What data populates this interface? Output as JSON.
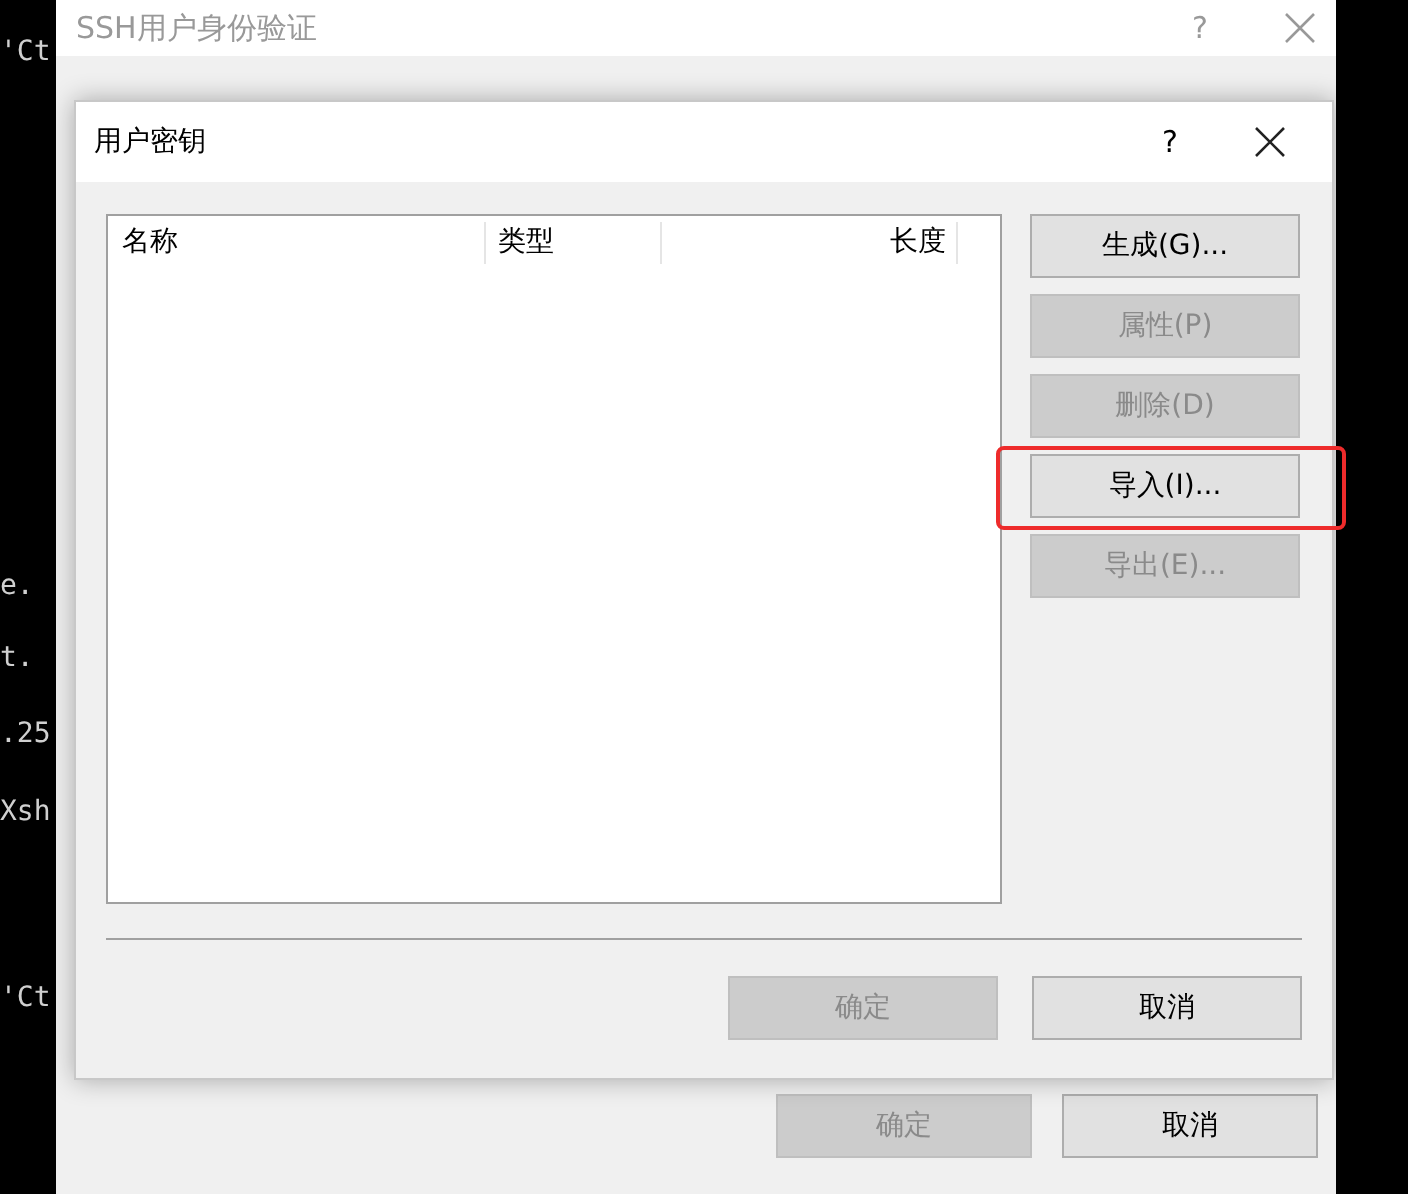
{
  "terminal_fragments": [
    {
      "text": "'Ct"
    },
    {
      "text": "e."
    },
    {
      "text": "t."
    },
    {
      "text": ".25"
    },
    {
      "text": "Xsh"
    },
    {
      "text": "'Ct"
    }
  ],
  "back_window": {
    "title": "SSH用户身份验证",
    "help": "?",
    "buttons": [
      {
        "label": "确定",
        "disabled": true
      },
      {
        "label": "取消",
        "disabled": false
      }
    ]
  },
  "dialog": {
    "title": "用户密钥",
    "help": "?",
    "table": {
      "columns": [
        "名称",
        "类型",
        "长度"
      ]
    },
    "side_buttons": [
      {
        "label": "生成(G)...",
        "disabled": false,
        "highlighted": false
      },
      {
        "label": "属性(P)",
        "disabled": true,
        "highlighted": false
      },
      {
        "label": "删除(D)",
        "disabled": true,
        "highlighted": false
      },
      {
        "label": "导入(I)...",
        "disabled": false,
        "highlighted": true
      },
      {
        "label": "导出(E)...",
        "disabled": true,
        "highlighted": false
      }
    ],
    "buttons": [
      {
        "label": "确定",
        "disabled": true
      },
      {
        "label": "取消",
        "disabled": false
      }
    ]
  }
}
